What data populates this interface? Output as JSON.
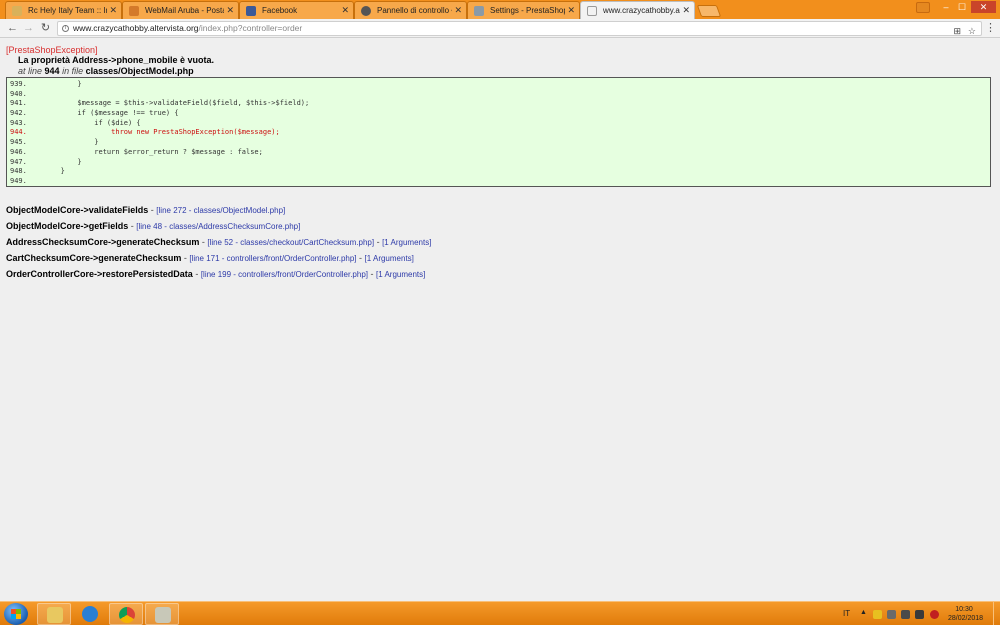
{
  "tabs": [
    {
      "label": "Rc Hely Italy Team :: Indi",
      "favicon_color": "#d9b15a"
    },
    {
      "label": "WebMail Aruba - Posta",
      "favicon_color": "#d47a2a"
    },
    {
      "label": "Facebook",
      "favicon_color": "#3b5998"
    },
    {
      "label": "Pannello di controllo • C",
      "favicon_color": "#555555"
    },
    {
      "label": "Settings - PrestaShop",
      "favicon_color": "#8a9aa8"
    },
    {
      "label": "www.crazycathobby.alte",
      "favicon_color": "#9a9a9a"
    }
  ],
  "window": {
    "minimize": "–",
    "maximize": "☐",
    "close": "✕"
  },
  "toolbar": {
    "back_icon": "←",
    "forward_icon": "→",
    "reload_icon": "↻",
    "url_host": "www.crazycathobby.altervista.org",
    "url_path": "/index.php?controller=order",
    "translate_icon": "⊞",
    "star_icon": "☆",
    "menu_icon": "⋮"
  },
  "exception": {
    "type": "[PrestaShopException]",
    "message": "La proprietà Address->phone_mobile è vuota.",
    "at_line_text": "at line",
    "line": "944",
    "in_file_text": "in file",
    "file": "classes/ObjectModel.php"
  },
  "code_lines": [
    {
      "text": "939.            }",
      "highlight": false
    },
    {
      "text": "940.",
      "highlight": false
    },
    {
      "text": "941.            $message = $this->validateField($field, $this->$field);",
      "highlight": false
    },
    {
      "text": "942.            if ($message !== true) {",
      "highlight": false
    },
    {
      "text": "943.                if ($die) {",
      "highlight": false
    },
    {
      "text": "944.                    throw new PrestaShopException($message);",
      "highlight": true
    },
    {
      "text": "945.                }",
      "highlight": false
    },
    {
      "text": "946.                return $error_return ? $message : false;",
      "highlight": false
    },
    {
      "text": "947.            }",
      "highlight": false
    },
    {
      "text": "948.        }",
      "highlight": false
    },
    {
      "text": "949.",
      "highlight": false
    }
  ],
  "stack_trace": [
    {
      "fn": "ObjectModelCore->validateFields",
      "loc": "[line 272 - classes/ObjectModel.php]",
      "args": ""
    },
    {
      "fn": "ObjectModelCore->getFields",
      "loc": "[line 48 - classes/AddressChecksumCore.php]",
      "args": ""
    },
    {
      "fn": "AddressChecksumCore->generateChecksum",
      "loc": "[line 52 - classes/checkout/CartChecksum.php]",
      "args": "[1 Arguments]"
    },
    {
      "fn": "CartChecksumCore->generateChecksum",
      "loc": "[line 171 - controllers/front/OrderController.php]",
      "args": "[1 Arguments]"
    },
    {
      "fn": "OrderControllerCore->restorePersistedData",
      "loc": "[line 199 - controllers/front/OrderController.php]",
      "args": "[1 Arguments]"
    }
  ],
  "taskbar": {
    "apps": [
      {
        "name": "file-explorer",
        "color": "#e8c860"
      },
      {
        "name": "internet-explorer",
        "color": "#2a7fd4"
      },
      {
        "name": "chrome",
        "color": "#ffffff"
      },
      {
        "name": "calculator",
        "color": "#c8c8b8"
      }
    ],
    "language": "IT",
    "tray_arrow": "▲",
    "time": "10:30",
    "date": "28/02/2018"
  }
}
